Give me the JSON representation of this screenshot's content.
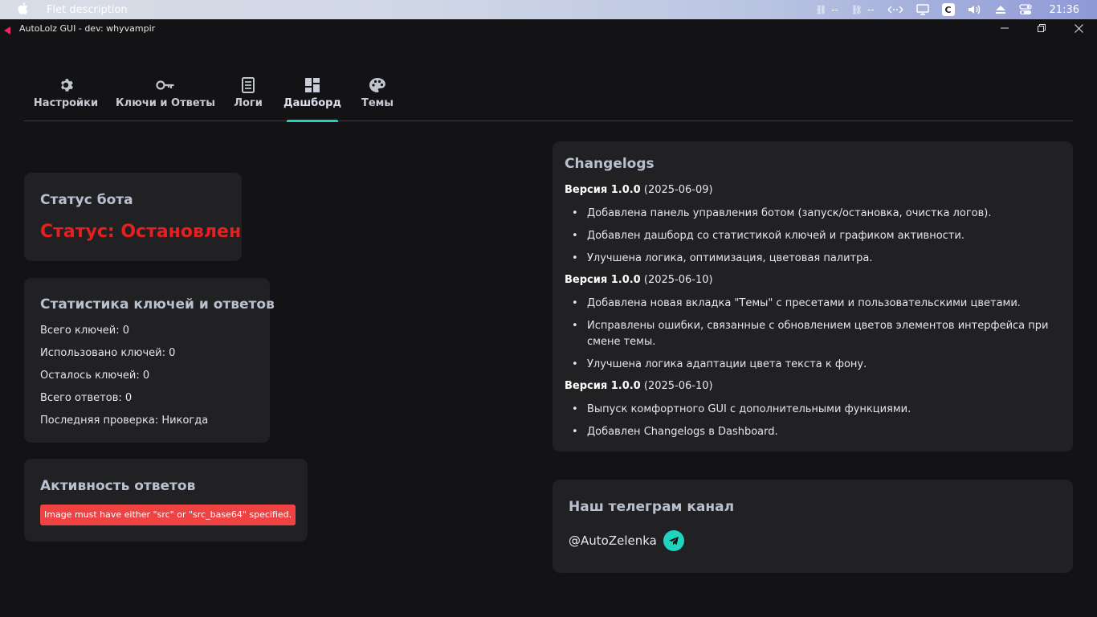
{
  "menubar": {
    "app_name": "Flet description",
    "tray": [
      "--",
      "--"
    ],
    "clock": "21:36",
    "cbox": "C"
  },
  "window": {
    "title": "AutoLolz GUI - dev: whyvampir"
  },
  "tabs": [
    {
      "label": "Настройки",
      "icon": "gear-icon",
      "active": false
    },
    {
      "label": "Ключи и Ответы",
      "icon": "key-icon",
      "active": false
    },
    {
      "label": "Логи",
      "icon": "log-icon",
      "active": false
    },
    {
      "label": "Дашборд",
      "icon": "dashboard-icon",
      "active": true
    },
    {
      "label": "Темы",
      "icon": "palette-icon",
      "active": false
    }
  ],
  "status_card": {
    "title": "Статус бота",
    "status": "Статус: Остановлен",
    "status_color": "#e61f1f"
  },
  "stats_card": {
    "title": "Статистика ключей и ответов",
    "lines": [
      "Всего ключей: 0",
      "Использовано ключей: 0",
      "Осталось ключей: 0",
      "Всего ответов: 0",
      "Последняя проверка: Никогда"
    ]
  },
  "activity_card": {
    "title": "Активность ответов",
    "error": "Image must have either \"src\" or \"src_base64\" specified."
  },
  "changelog": {
    "title": "Changelogs",
    "versions": [
      {
        "version": "Версия 1.0.0",
        "date": " (2025-06-09)",
        "items": [
          "Добавлена панель управления ботом (запуск/остановка, очистка логов).",
          "Добавлен дашборд со статистикой ключей и графиком активности.",
          "Улучшена логика, оптимизация, цветовая палитра."
        ]
      },
      {
        "version": "Версия 1.0.0",
        "date": " (2025-06-10)",
        "items": [
          "Добавлена новая вкладка \"Темы\" с пресетами и пользовательскими цветами.",
          "Исправлены ошибки, связанные с обновлением цветов элементов интерфейса при смене темы.",
          "Улучшена логика адаптации цвета текста к фону."
        ]
      },
      {
        "version": "Версия 1.0.0",
        "date": " (2025-06-10)",
        "items": [
          "Выпуск комфортного GUI с дополнительными функциями.",
          "Добавлен Changelogs в Dashboard."
        ]
      }
    ]
  },
  "telegram_card": {
    "title": "Наш телеграм канал",
    "handle": "@AutoZelenka",
    "icon": "telegram-icon"
  },
  "colors": {
    "accent": "#1fd3be",
    "background": "#131315",
    "card": "#212124",
    "error": "#ef4343"
  }
}
